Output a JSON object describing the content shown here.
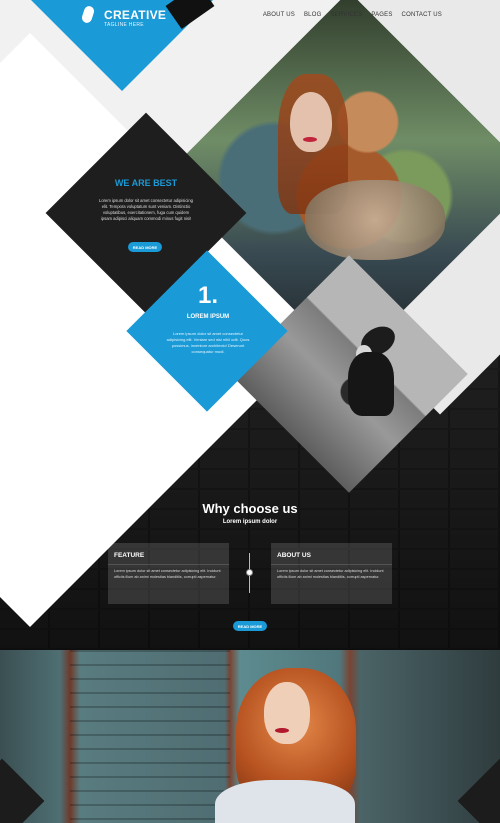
{
  "header": {
    "logo_title": "CREATIVE",
    "logo_tagline": "TAGLINE HERE",
    "nav": [
      "ABOUT US",
      "BLOG",
      "SERVICES",
      "PAGES",
      "CONTACT US"
    ]
  },
  "best": {
    "title": "WE ARE BEST",
    "text": "Lorem ipsum dolor sit amet consectetur adipisicing elit. Tempora voluptatum sunt veniam. Distinctio voluptatibus, exercitationem, fuga cum quidem ipsam adipisci aliquam commodi minus fugit nisi!",
    "button": "READ MORE"
  },
  "step": {
    "number": "1.",
    "title": "LOREM IPSUM",
    "text": "Lorem ipsum dolor sit amet consectetur adipisicing elit. Veniam sed nisi nihil odit. Quos possimus, inventore architecto! Deserunt consequatur modi."
  },
  "why": {
    "title": "Why choose us",
    "subtitle": "Lorem ipsum dolor",
    "cards": [
      {
        "title": "FEATURE",
        "text": "Lorem ipsum dolor sit amet consectetur adipisicing elit. Incidunt officiis illum ab animi molestias blanditiis, corrupti aspernatur."
      },
      {
        "title": "ABOUT US",
        "text": "Lorem ipsum dolor sit amet consectetur adipisicing elit. Incidunt officiis illum ab animi molestias blanditiis, corrupti aspernatur."
      }
    ],
    "button": "READ MORE"
  },
  "colors": {
    "accent": "#1a9ad6",
    "dark": "#1e1e1e"
  },
  "icons": [
    "logo-pill-icon",
    "timeline-dot-icon"
  ]
}
